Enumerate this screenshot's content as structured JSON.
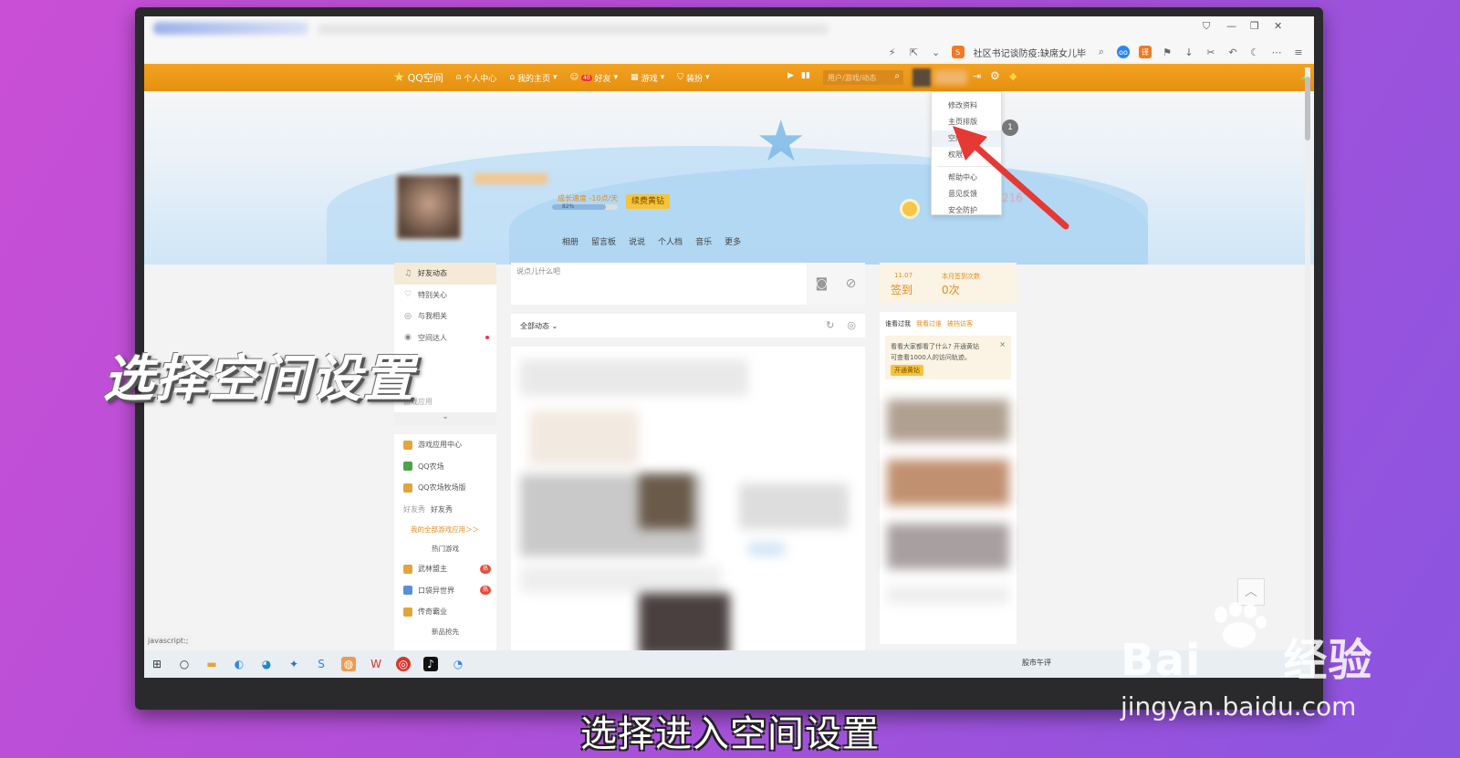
{
  "browser": {
    "address_text": "社区书记谈防疫:缺席女儿毕",
    "window_controls": [
      "⛉",
      "—",
      "❐",
      "✕"
    ]
  },
  "qq_bar": {
    "logo": "QQ空间",
    "nav": [
      "个人中心",
      "我的主页",
      "好友",
      "游戏",
      "装扮"
    ],
    "friends_badge": "40",
    "search_placeholder": "用户/游戏/动态"
  },
  "profile": {
    "growth_speed": "成长速度 -10点/天",
    "progress_label": "82%",
    "progress_value": 0.82,
    "renew_button": "续费黄钻",
    "tabs": [
      "相册",
      "留言板",
      "说说",
      "个人档",
      "音乐",
      "更多"
    ],
    "right_number": "216"
  },
  "dropdown": {
    "items_top": [
      "修改资料",
      "主页排版",
      "空间设置",
      "权限"
    ],
    "items_bottom": [
      "帮助中心",
      "意见反馈",
      "安全防护"
    ],
    "active_index": 2,
    "badge": "1"
  },
  "left_nav": {
    "items": [
      {
        "label": "好友动态",
        "icon": "bell-icon"
      },
      {
        "label": "特别关心",
        "icon": "heart-icon"
      },
      {
        "label": "与我相关",
        "icon": "at-icon"
      },
      {
        "label": "空间达人",
        "icon": "play-circle-icon"
      }
    ],
    "hidden_item": "游戏应用",
    "apps": [
      {
        "label": "游戏应用中心",
        "icon": "game-icon"
      },
      {
        "label": "QQ农场",
        "icon": "farm-icon"
      },
      {
        "label": "QQ农场牧场版",
        "icon": "ranch-icon"
      },
      {
        "label": "好友秀",
        "icon": "friend-show-icon",
        "alt": "好友秀"
      }
    ],
    "all_apps_link": "我的全部游戏应用＞＞",
    "hot_games_title": "热门游戏",
    "hot_games": [
      {
        "label": "武林盟主",
        "badge": "热"
      },
      {
        "label": "口袋异世界",
        "badge": "热"
      },
      {
        "label": "传奇霸业",
        "badge": ""
      }
    ],
    "more_label": "新品抢先"
  },
  "center": {
    "post_placeholder": "说点儿什么吧",
    "filter_label": "全部动态"
  },
  "right": {
    "checkin_date": "11.07",
    "checkin_label": "签到",
    "month_label": "本月签到次数",
    "month_count": "0次",
    "visitor_tabs": [
      "谁看过我",
      "我看过谁",
      "被挡访客"
    ],
    "notice_line1": "看看大家都看了什么? 开通黄钻",
    "notice_line2": "可查看1000人的访问轨迹。",
    "open_button": "开通黄钻"
  },
  "status_bar": "javascript:;",
  "taskbar": {
    "stocks": "股市午评"
  },
  "overlay": {
    "big_caption": "选择空间设置",
    "subtitle": "选择进入空间设置",
    "watermark_brand": "Bai",
    "watermark_cn": "经验",
    "watermark_url": "jingyan.baidu.com"
  },
  "colors": {
    "qq_orange": "#e99812",
    "arrow_red": "#e53935",
    "accent_text": "#e68a1c"
  }
}
